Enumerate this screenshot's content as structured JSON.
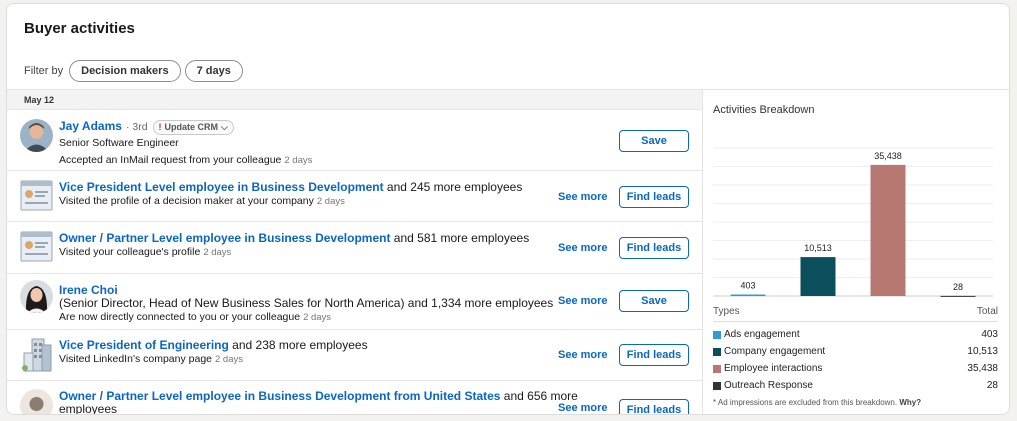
{
  "header": {
    "title": "Buyer activities"
  },
  "filters": {
    "label": "Filter by",
    "pills": [
      "Decision makers",
      "7 days"
    ]
  },
  "feed": {
    "date": "May 12",
    "rows": [
      {
        "name": "Jay Adams",
        "degree": "· 3rd",
        "crm_label": "Update CRM",
        "crm_warn": "!",
        "crm_chev": "⌵",
        "headline": "Senior Software Engineer",
        "activity": "Accepted an InMail request from your colleague",
        "ago": "2 days",
        "button": "Save"
      },
      {
        "link": "Vice President Level employee in Business Development",
        "tail": " and 245 more employees",
        "activity": "Visited the profile of a decision maker at your company",
        "ago": "2 days",
        "see_more": "See more",
        "button": "Find leads"
      },
      {
        "link": "Owner / Partner Level employee in Business Development",
        "tail": " and 581 more employees",
        "activity": "Visited your colleague's profile",
        "ago": "2 days",
        "see_more": "See more",
        "button": "Find leads"
      },
      {
        "name": "Irene Choi",
        "headline": "(Senior Director, Head of New Business Sales for North America) and 1,334 more employees",
        "activity": "Are now directly connected to you or your colleague",
        "ago": "2 days",
        "see_more": "See more",
        "button": "Save"
      },
      {
        "link": "Vice President of Engineering",
        "tail": " and 238 more employees",
        "activity": "Visited LinkedIn's company page",
        "ago": "2 days",
        "see_more": "See more",
        "button": "Find leads"
      },
      {
        "link": "Owner / Partner Level employee in Business Development from United States",
        "tail": " and 656 more",
        "activity": "employees",
        "see_more": "See more",
        "button": "Find leads"
      }
    ]
  },
  "breakdown": {
    "title": "Activities Breakdown",
    "types_label": "Types",
    "total_label": "Total",
    "footnote": "* Ad impressions are excluded from this breakdown.",
    "footnote_link": "Why?"
  },
  "chart_data": {
    "type": "bar",
    "categories": [
      "Ads engagement",
      "Company engagement",
      "Employee interactions",
      "Outreach Response"
    ],
    "values": [
      403,
      10513,
      35438,
      28
    ],
    "value_labels": [
      "403",
      "10,513",
      "35,438",
      "28"
    ],
    "colors": [
      "#2e9bd6",
      "#0b4f5c",
      "#b87872",
      "#333333"
    ],
    "ylim": [
      0,
      40000
    ],
    "grid": true
  }
}
